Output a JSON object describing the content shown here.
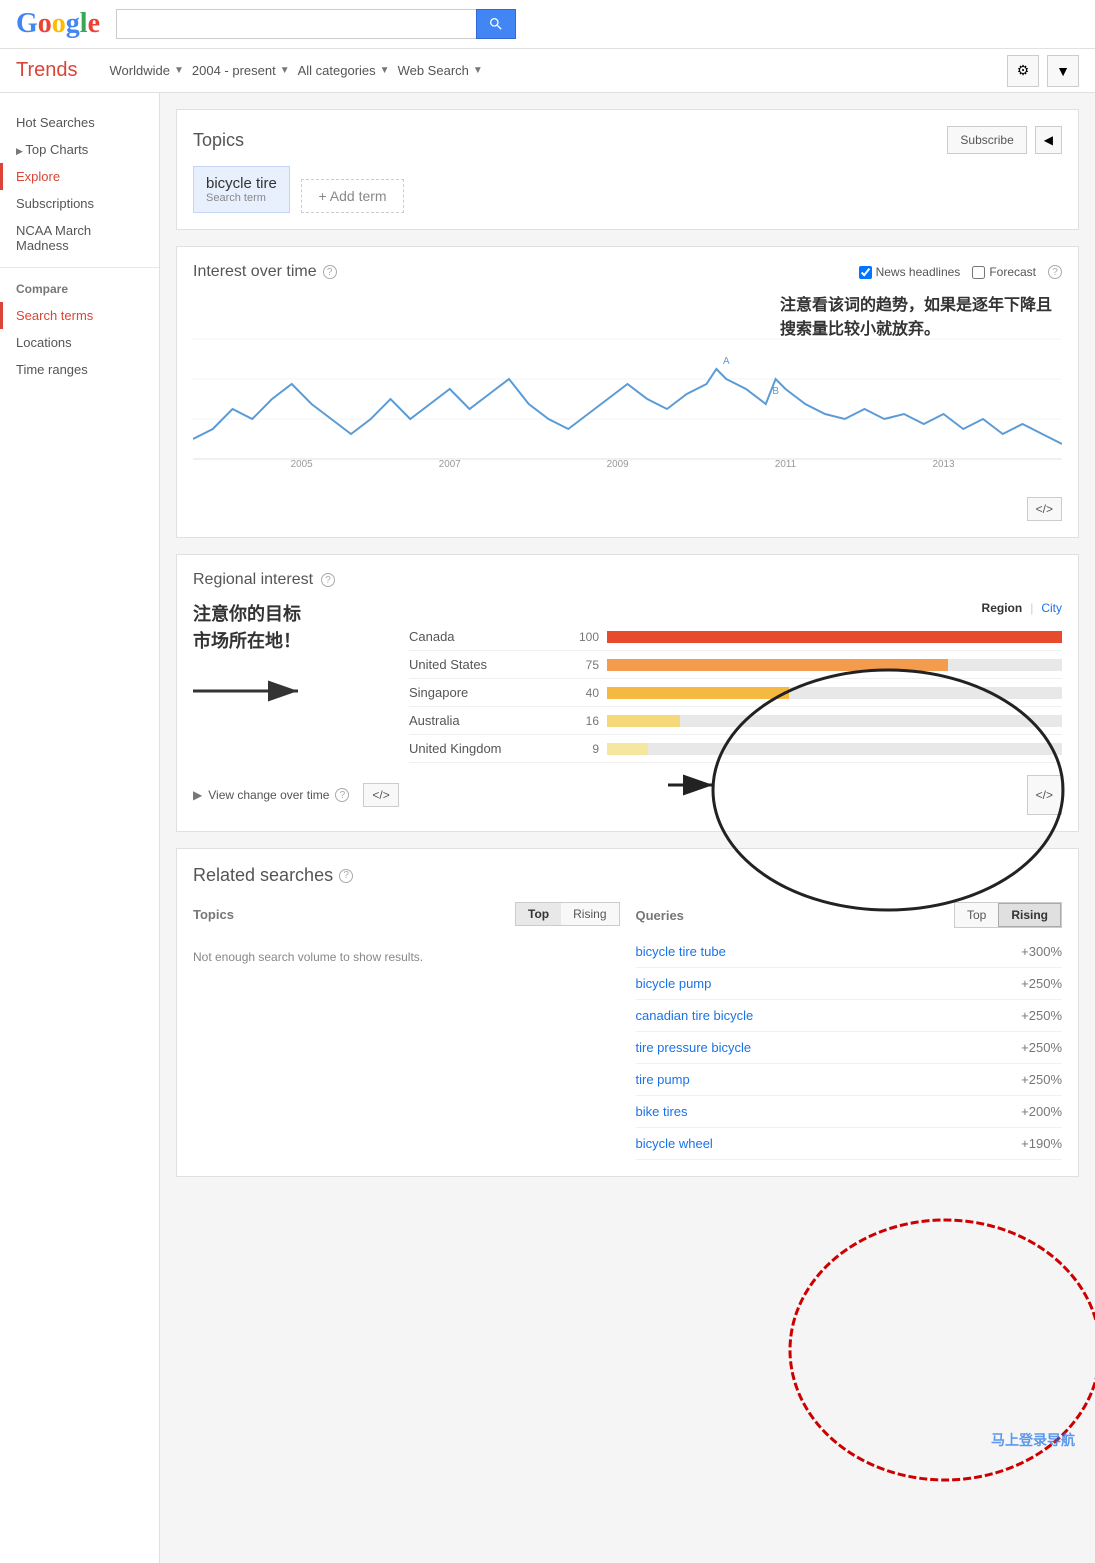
{
  "header": {
    "search_placeholder": "",
    "search_value": ""
  },
  "nav": {
    "brand": "Trends",
    "worldwide_label": "Worldwide",
    "date_label": "2004 - present",
    "categories_label": "All categories",
    "search_type_label": "Web Search"
  },
  "sidebar": {
    "hot_searches": "Hot Searches",
    "top_charts": "Top Charts",
    "explore": "Explore",
    "subscriptions": "Subscriptions",
    "ncaa": "NCAA March Madness",
    "compare_label": "Compare",
    "search_terms": "Search terms",
    "locations": "Locations",
    "time_ranges": "Time ranges"
  },
  "topics": {
    "title": "Topics",
    "subscribe_label": "Subscribe",
    "share_label": "◀",
    "term_label": "bicycle tire",
    "term_sub": "Search term",
    "add_term_label": "+ Add term"
  },
  "interest": {
    "title": "Interest over time",
    "news_headlines_label": "News headlines",
    "forecast_label": "Forecast",
    "annotation": "注意看该词的趋势，如果是逐年下降且\n搜索量比较小就放弃。",
    "years": [
      "2005",
      "2007",
      "2009",
      "2011",
      "2013"
    ],
    "embed_label": "</>",
    "embed_label2": "</>"
  },
  "regional": {
    "title": "Regional interest",
    "region_label": "Region",
    "city_label": "City",
    "annotation": "注意你的目标\n市场所在地！",
    "embed_label": "</>",
    "view_change_label": "View change over time",
    "regions": [
      {
        "name": "Canada",
        "value": 100,
        "pct": 100
      },
      {
        "name": "United States",
        "value": 75,
        "pct": 75
      },
      {
        "name": "Singapore",
        "value": 40,
        "pct": 40
      },
      {
        "name": "Australia",
        "value": 16,
        "pct": 16
      },
      {
        "name": "United Kingdom",
        "value": 9,
        "pct": 9
      }
    ]
  },
  "related": {
    "title": "Related searches",
    "topics_label": "Topics",
    "queries_label": "Queries",
    "top_label": "Top",
    "rising_label": "Rising",
    "no_data": "Not enough search volume to show results.",
    "queries": [
      {
        "name": "bicycle tire tube",
        "pct": "+300%"
      },
      {
        "name": "bicycle pump",
        "pct": "+250%"
      },
      {
        "name": "canadian tire bicycle",
        "pct": "+250%"
      },
      {
        "name": "tire pressure bicycle",
        "pct": "+250%"
      },
      {
        "name": "tire pump",
        "pct": "+250%"
      },
      {
        "name": "bike tires",
        "pct": "+200%"
      },
      {
        "name": "bicycle wheel",
        "pct": "+190%"
      }
    ]
  }
}
